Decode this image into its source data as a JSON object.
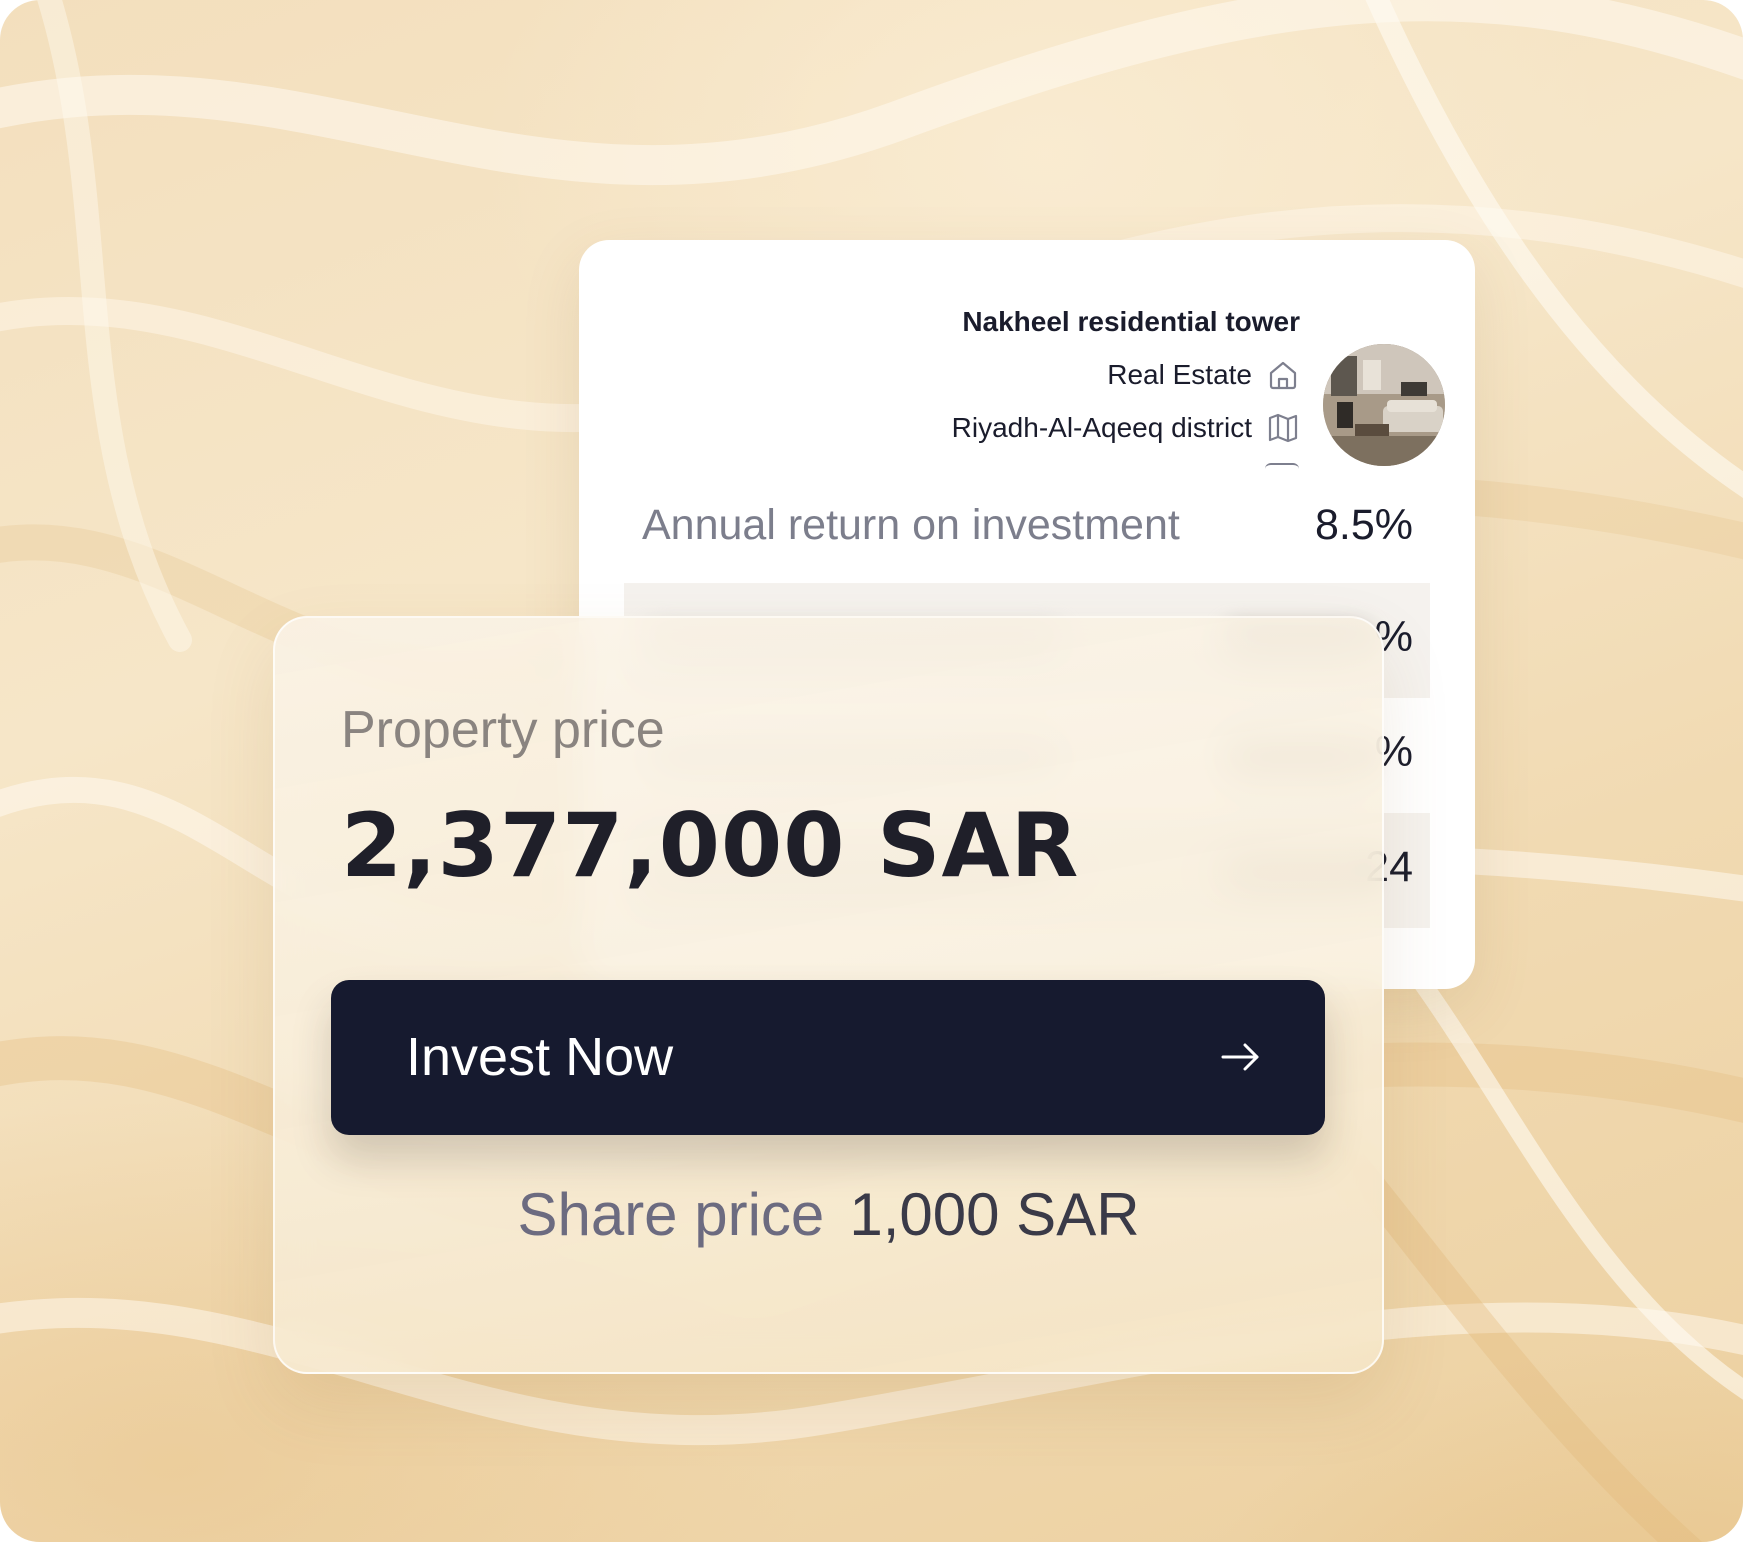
{
  "property": {
    "title": "Nakheel residential tower",
    "category": "Real Estate",
    "category_icon": "home-icon",
    "location": "Riyadh-Al-Aqeeq district",
    "location_icon": "map-icon"
  },
  "stats": {
    "roi_label": "Annual return on investment",
    "roi_value": "8.5%",
    "row2_tail": "%",
    "row3_tail": "%",
    "row4_tail": "24"
  },
  "pricing": {
    "property_price_label": "Property price",
    "property_price_value": "2,377,000 SAR",
    "share_price_label": "Share price",
    "share_price_value": "1,000 SAR"
  },
  "cta": {
    "invest_label": "Invest Now",
    "icon": "arrow-right-icon"
  },
  "colors": {
    "button_bg": "#161a2f",
    "background": "#f3dfbd",
    "text_dark": "#1a1c2c",
    "text_muted": "#7c7e8c"
  }
}
